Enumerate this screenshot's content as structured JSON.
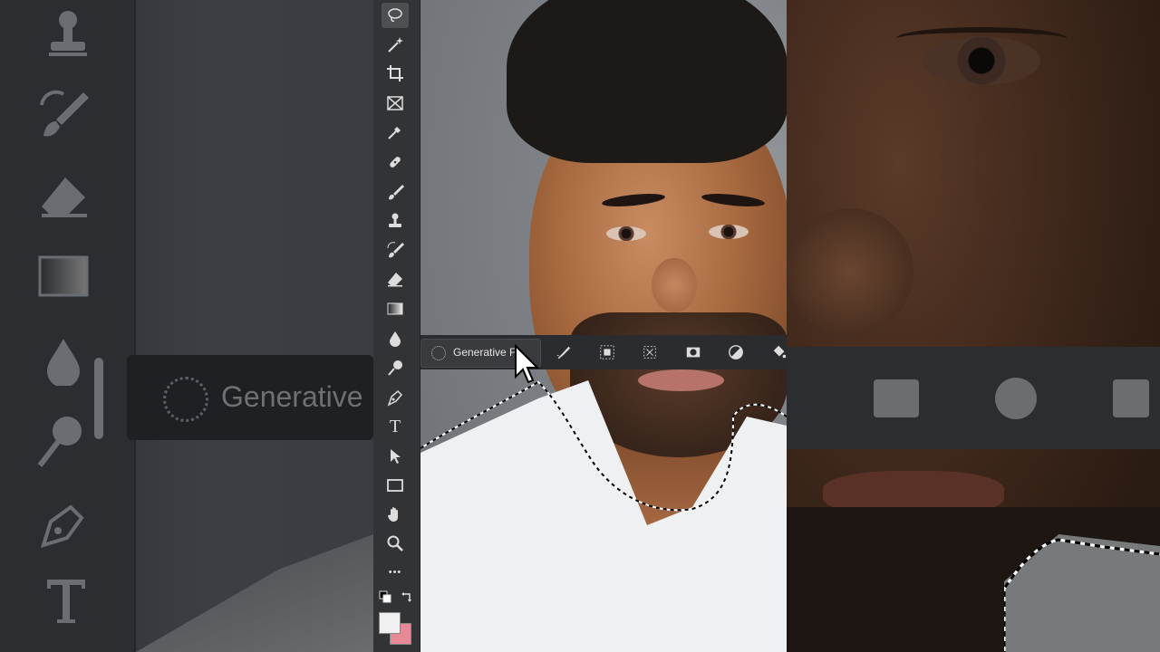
{
  "contextual_taskbar": {
    "generative_fill_label": "Generative Fi",
    "background_generative_label": "Generative"
  },
  "colors": {
    "toolbar_bg": "#323335",
    "taskbar_bg": "#2b2c2f",
    "foreground_swatch": "#f0f0f0",
    "background_swatch": "#e88a96"
  },
  "tools": [
    {
      "name": "lasso-tool-icon",
      "active": true
    },
    {
      "name": "magic-wand-icon"
    },
    {
      "name": "crop-icon"
    },
    {
      "name": "frame-icon"
    },
    {
      "name": "eyedropper-icon"
    },
    {
      "name": "spot-healing-icon"
    },
    {
      "name": "brush-icon"
    },
    {
      "name": "clone-stamp-icon"
    },
    {
      "name": "history-brush-icon"
    },
    {
      "name": "eraser-icon"
    },
    {
      "name": "gradient-icon"
    },
    {
      "name": "blur-icon"
    },
    {
      "name": "dodge-icon"
    },
    {
      "name": "pen-icon"
    },
    {
      "name": "type-icon"
    },
    {
      "name": "move-selection-icon"
    },
    {
      "name": "rectangle-icon"
    },
    {
      "name": "hand-icon"
    },
    {
      "name": "zoom-icon"
    },
    {
      "name": "more-tools-icon"
    }
  ],
  "toolbar_glyphs": {
    "type": "T",
    "more": "•••"
  }
}
